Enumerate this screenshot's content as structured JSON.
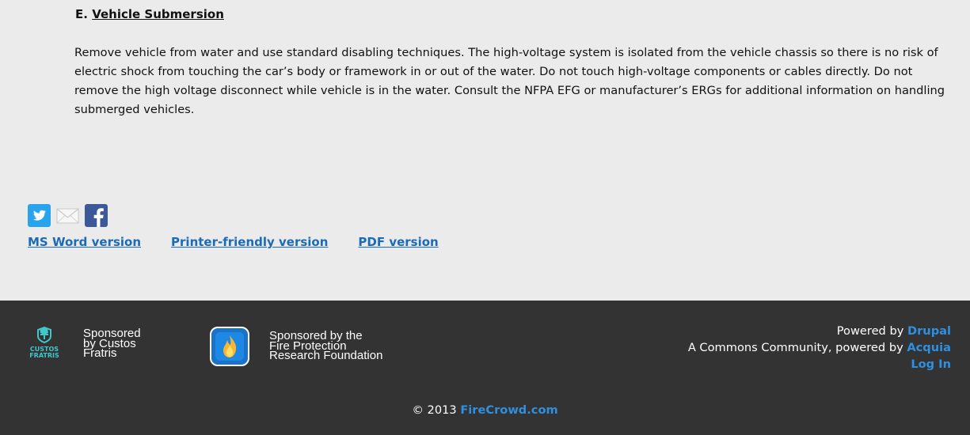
{
  "section": {
    "heading_prefix": "E.",
    "heading_title": "Vehicle Submersion",
    "body": "Remove vehicle from water and use standard disabling techniques.  The high-voltage system is isolated from the vehicle chassis so there is no risk of electric shock from touching the car’s body or framework in or out of the water.  Do not touch high-voltage components or cables directly.  Do not remove the high voltage disconnect while vehicle is in the water.  Consult the NFPA EFG or manufacturer’s ERGs for additional information on handling submerged vehicles."
  },
  "share": {
    "icons": [
      "twitter-icon",
      "email-icon",
      "facebook-icon"
    ]
  },
  "versions": {
    "ms_word": "MS Word version",
    "printer": "Printer-friendly version",
    "pdf": "PDF version"
  },
  "footer": {
    "sponsor1": {
      "logo_line1": "CUSTOS",
      "logo_line2": "FRATRIS",
      "line1": "Sponsored",
      "line2": "by Custos",
      "line3": "Fratris"
    },
    "sponsor2": {
      "line1": "Sponsored by the",
      "line2": "Fire Protection",
      "line3": "Research Foundation"
    },
    "powered_prefix": "Powered by",
    "drupal": "Drupal",
    "commons_prefix": "A Commons Community, powered by",
    "acquia": "Acquia",
    "login": "Log In",
    "copyright_prefix": "© 2013",
    "firecrowd": "FireCrowd.com"
  },
  "colors": {
    "background": "#ebebeb",
    "footer": "#333333",
    "link": "#1a6bb8",
    "footer_link": "#2f8fe0"
  }
}
